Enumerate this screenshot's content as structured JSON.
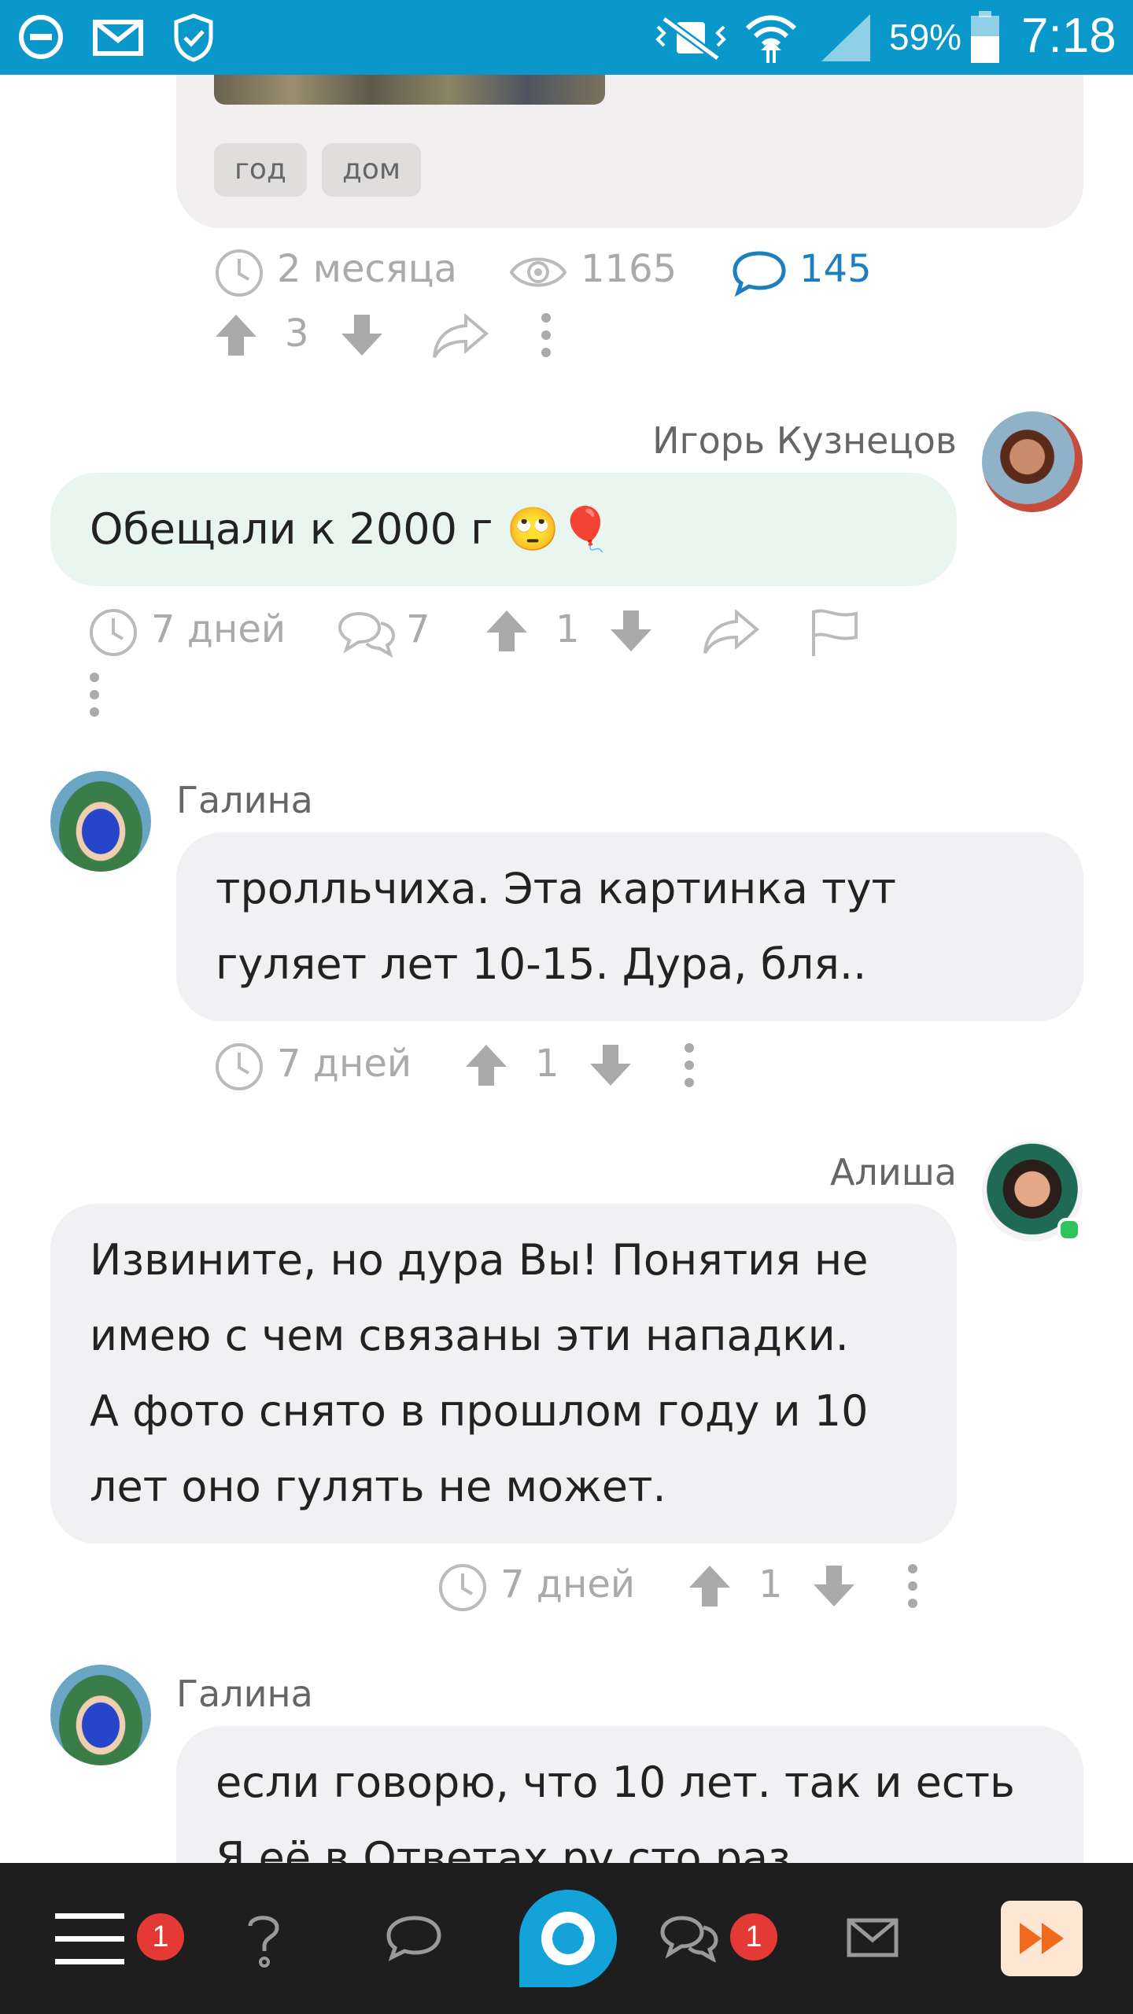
{
  "status_bar": {
    "battery": "59%",
    "time": "7:18"
  },
  "post": {
    "tags": [
      "год",
      "дом"
    ],
    "time_ago": "2 месяца",
    "views": "1165",
    "comments": "145",
    "rating": "3"
  },
  "comments": [
    {
      "author": "Игорь Кузнецов",
      "text": "Обещали к 2000 г 🙄🎈",
      "time_ago": "7 дней",
      "replies": "7",
      "rating": "1"
    },
    {
      "author": "Галина",
      "text_lines": [
        "тролльчиха. Эта картинка тут",
        "гуляет лет 10-15. Дура, бля.."
      ],
      "time_ago": "7 дней",
      "rating": "1"
    },
    {
      "author": "Алиша",
      "text_lines": [
        "Извините, но дура Вы! Понятия не",
        "имею с чем связаны эти нападки.",
        "А фото снято в прошлом году и 10",
        "лет оно гулять не может."
      ],
      "time_ago": "7 дней",
      "rating": "1"
    },
    {
      "author": "Галина",
      "text_lines": [
        "если говорю, что 10 лет. так и есть",
        "Я её в Ответах.ру сто раз"
      ]
    }
  ],
  "bottom_nav": {
    "menu_badge": "1",
    "chats_badge": "1"
  },
  "colors": {
    "status_bar": "#0a97c9",
    "accent_blue": "#1b7fc0",
    "bottom_bar": "#1e1e1e",
    "badge_red": "#e53935",
    "fast_forward": "#f06a1e"
  }
}
